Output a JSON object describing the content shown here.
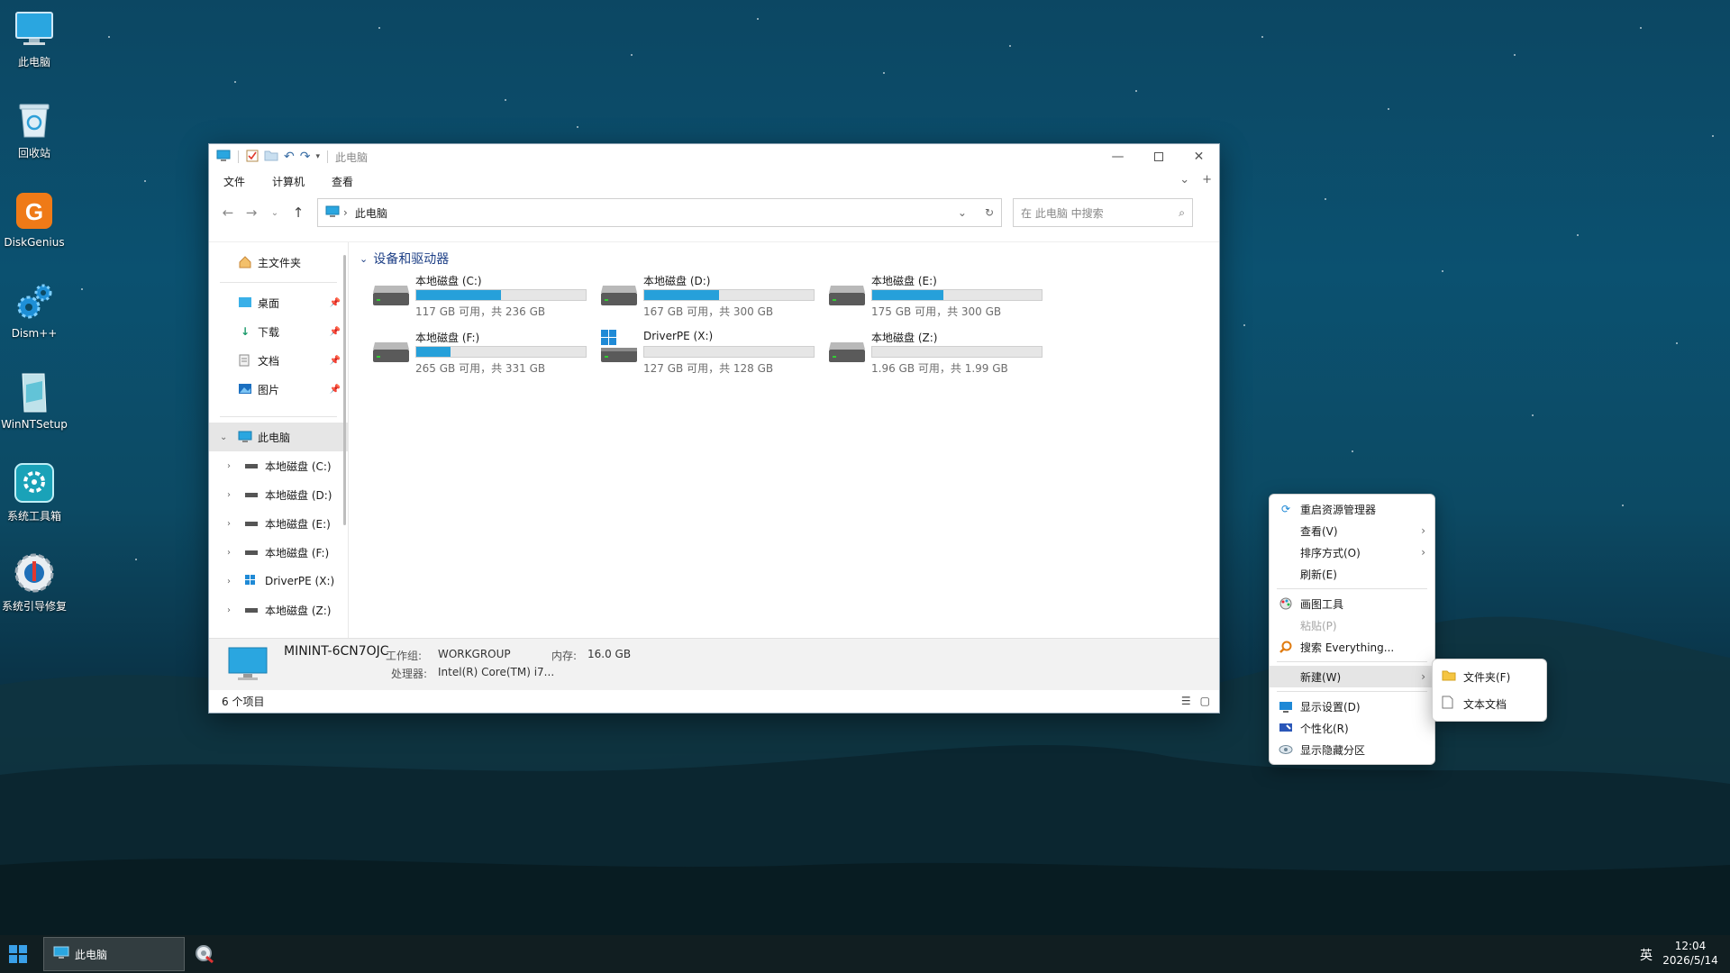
{
  "desktop": {
    "icons": [
      {
        "label": "此电脑",
        "icon": "this-pc-icon"
      },
      {
        "label": "回收站",
        "icon": "recycle-bin-icon"
      },
      {
        "label": "DiskGenius",
        "icon": "diskgenius-icon"
      },
      {
        "label": "Dism++",
        "icon": "dism-gear-icon"
      },
      {
        "label": "WinNTSetup",
        "icon": "winntsetup-icon"
      },
      {
        "label": "系统工具箱",
        "icon": "toolbox-icon"
      },
      {
        "label": "系统引导修复",
        "icon": "boot-repair-icon"
      }
    ]
  },
  "explorer": {
    "title": "此电脑",
    "menu": [
      "文件",
      "计算机",
      "查看"
    ],
    "address": "此电脑",
    "search_placeholder": "在 此电脑 中搜索",
    "nav": {
      "home": "主文件夹",
      "quick": [
        "桌面",
        "下载",
        "文档",
        "图片"
      ],
      "this_pc": "此电脑",
      "drives": [
        "本地磁盘 (C:)",
        "本地磁盘 (D:)",
        "本地磁盘 (E:)",
        "本地磁盘 (F:)",
        "DriverPE (X:)",
        "本地磁盘 (Z:)"
      ]
    },
    "group_title": "设备和驱动器",
    "drives": [
      {
        "name": "本地磁盘 (C:)",
        "free_text": "117 GB 可用，共 236 GB",
        "used_fraction": 0.5
      },
      {
        "name": "本地磁盘 (D:)",
        "free_text": "167 GB 可用，共 300 GB",
        "used_fraction": 0.44
      },
      {
        "name": "本地磁盘 (E:)",
        "free_text": "175 GB 可用，共 300 GB",
        "used_fraction": 0.42
      },
      {
        "name": "本地磁盘 (F:)",
        "free_text": "265 GB 可用，共 331 GB",
        "used_fraction": 0.2
      },
      {
        "name": "DriverPE (X:)",
        "free_text": "127 GB 可用，共 128 GB",
        "used_fraction": 0.008
      },
      {
        "name": "本地磁盘 (Z:)",
        "free_text": "1.96 GB 可用，共 1.99 GB",
        "used_fraction": 0.015
      }
    ],
    "details": {
      "computer_name": "MININT-6CN7OJC",
      "workgroup_label": "工作组:",
      "workgroup_value": "WORKGROUP",
      "memory_label": "内存:",
      "memory_value": "16.0 GB",
      "cpu_label": "处理器:",
      "cpu_value": "Intel(R) Core(TM) i7..."
    },
    "status": "6 个项目"
  },
  "context_menu": {
    "items": [
      {
        "label": "重启资源管理器",
        "icon": "refresh-explorer-icon"
      },
      {
        "label": "查看(V)",
        "submenu": true
      },
      {
        "label": "排序方式(O)",
        "submenu": true
      },
      {
        "label": "刷新(E)"
      },
      {
        "label": "画图工具",
        "icon": "paint-icon"
      },
      {
        "label": "粘贴(P)",
        "disabled": true
      },
      {
        "label": "搜索 Everything...",
        "icon": "everything-search-icon"
      },
      {
        "label": "新建(W)",
        "submenu": true,
        "highlighted": true
      },
      {
        "label": "显示设置(D)",
        "icon": "display-settings-icon"
      },
      {
        "label": "个性化(R)",
        "icon": "personalize-icon"
      },
      {
        "label": "显示隐藏分区",
        "icon": "hidden-partition-icon"
      }
    ],
    "new_submenu": [
      {
        "label": "文件夹(F)",
        "icon": "folder-icon"
      },
      {
        "label": "文本文档",
        "icon": "text-document-icon"
      }
    ]
  },
  "taskbar": {
    "active_window": "此电脑",
    "ime": "英",
    "time": "12:04",
    "date": "2026/5/14"
  },
  "colors": {
    "accent": "#26a0da",
    "group_header": "#1d3f86"
  }
}
